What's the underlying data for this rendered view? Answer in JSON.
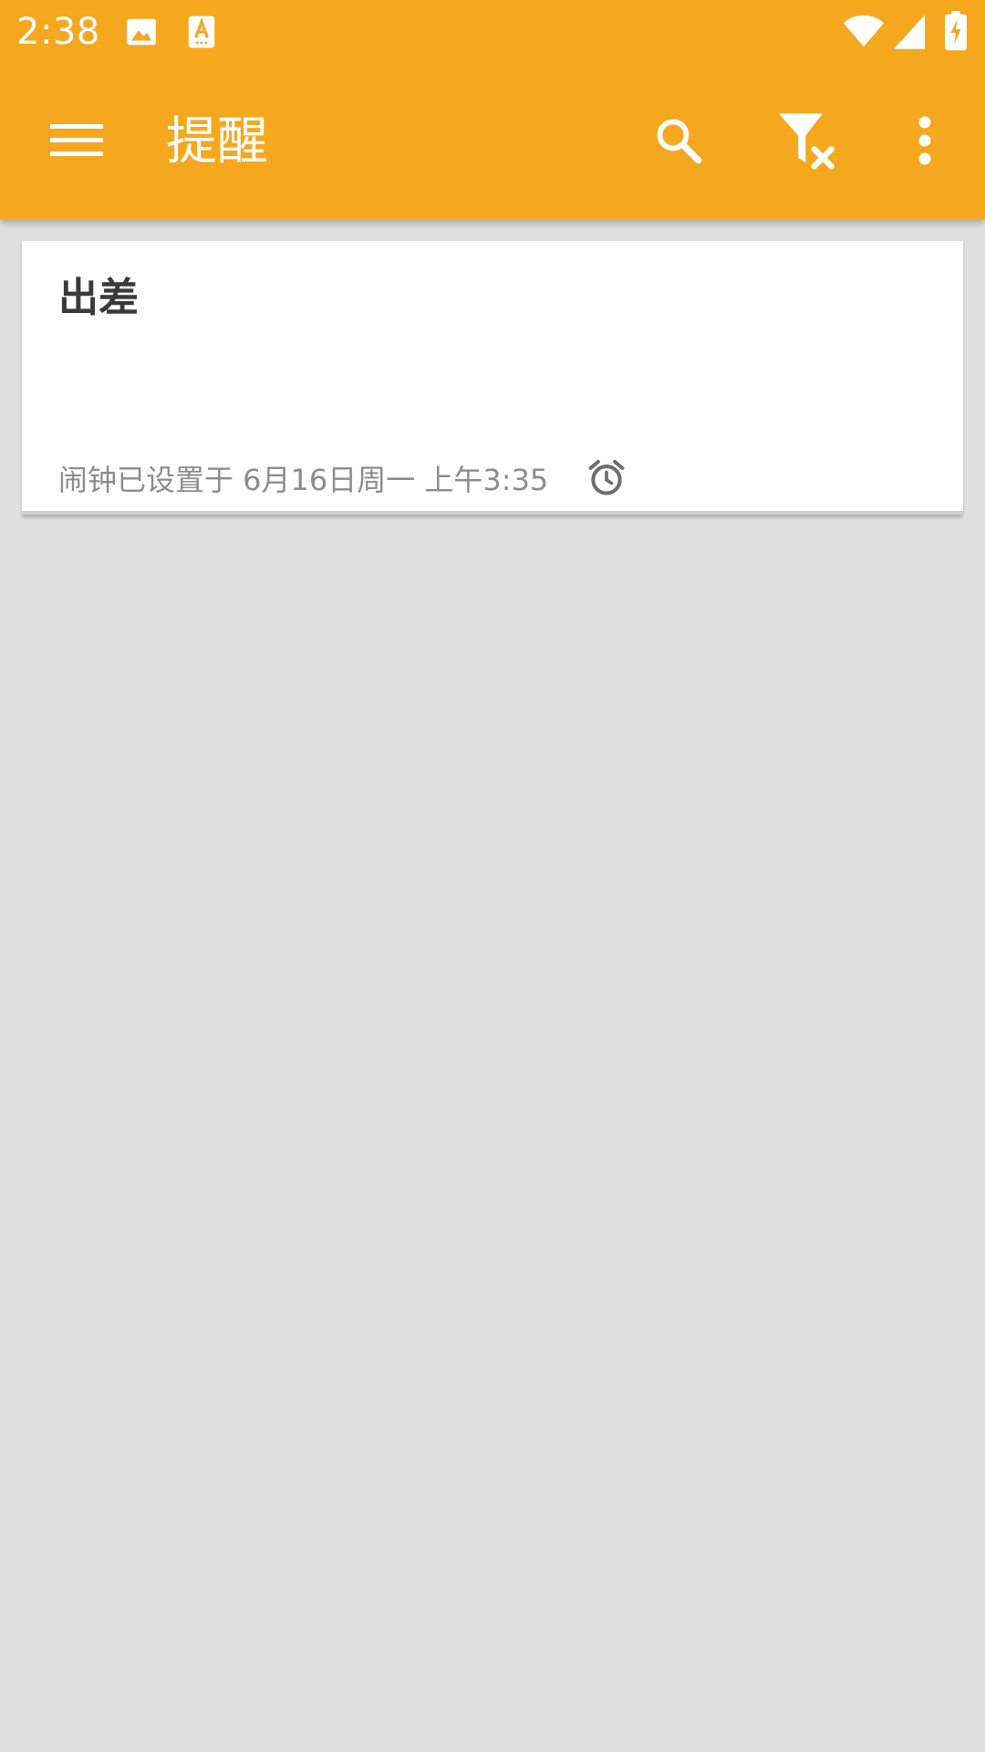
{
  "status_bar": {
    "time": "2:38",
    "icons": [
      "image-icon",
      "text-a-icon",
      "wifi-icon",
      "cell-signal-icon",
      "battery-charging-icon"
    ]
  },
  "toolbar": {
    "title": "提醒",
    "icons": [
      "menu-icon",
      "search-icon",
      "filter-clear-icon",
      "more-vert-icon"
    ]
  },
  "reminders": [
    {
      "title": "出差",
      "alarm_text": "闹钟已设置于 6月16日周一 上午3:35",
      "icon": "alarm-clock-icon"
    }
  ],
  "colors": {
    "primary": "#F5A71E",
    "background": "#E0E0E0",
    "card": "#FFFFFF",
    "title_text": "#3A3A3A",
    "meta_text": "#8C8C8C"
  }
}
